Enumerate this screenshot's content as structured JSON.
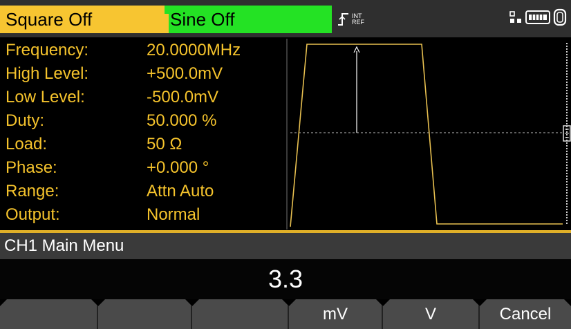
{
  "header": {
    "ch1_tab": "Square Off",
    "ch2_tab": "Sine Off",
    "trigger_label_top": "INT",
    "trigger_label_bottom": "REF"
  },
  "params": [
    {
      "label": "Frequency:",
      "value": "20.0000MHz"
    },
    {
      "label": "High Level:",
      "value": "+500.0mV"
    },
    {
      "label": "Low Level:",
      "value": "-500.0mV"
    },
    {
      "label": "Duty:",
      "value": "50.000 %"
    },
    {
      "label": "Load:",
      "value": "50 Ω"
    },
    {
      "label": "Phase:",
      "value": "+0.000 °"
    },
    {
      "label": "Range:",
      "value": "Attn Auto"
    },
    {
      "label": "Output:",
      "value": "Normal"
    }
  ],
  "menu": {
    "title": "CH1  Main Menu"
  },
  "entry": {
    "value": "3.3"
  },
  "softkeys": [
    "",
    "",
    "",
    "mV",
    "V",
    "Cancel"
  ],
  "colors": {
    "ch1": "#f7c531",
    "ch2": "#24e224",
    "param_text": "#f5c32c",
    "trace": "#e8c050"
  }
}
